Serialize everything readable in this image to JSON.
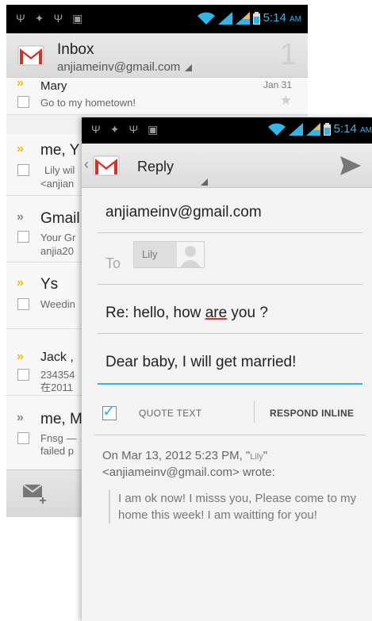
{
  "status_bar": {
    "time": "5:14",
    "ampm": "AM"
  },
  "inbox": {
    "title": "Inbox",
    "account": "anjiameinv@gmail.com",
    "unread_count": "1",
    "messages": [
      {
        "sender": "Mary",
        "preview_line1": "Go to my hometown!",
        "preview_line2": "",
        "date": "Jan 31",
        "important": true
      },
      {
        "sender": "me, Y",
        "preview_line1": "Lily wil",
        "preview_line2": "<anjian",
        "date": "",
        "important": true
      },
      {
        "sender": "Gmail",
        "preview_line1": "Your Gr",
        "preview_line2": "anjia20",
        "date": "",
        "important": false
      },
      {
        "sender": "Ys",
        "preview_line1": "Weedin",
        "preview_line2": "",
        "date": "",
        "important": true
      },
      {
        "sender": "Jack ,",
        "preview_line1": "234354",
        "preview_line2": "在2011",
        "date": "",
        "important": true
      },
      {
        "sender": "me, M",
        "preview_line1": "Fnsg —",
        "preview_line2": "failed p",
        "date": "",
        "important": false
      }
    ]
  },
  "reply": {
    "title": "Reply",
    "from": "anjiameinv@gmail.com",
    "to_label": "To",
    "recipient": "Lily",
    "subject_before": "Re: hello, how ",
    "subject_misspelled": "are",
    "subject_after": " you ?",
    "body": "Dear baby, I will get married!",
    "quote_text_label": "QUOTE TEXT",
    "quote_text_checked": true,
    "respond_inline_label": "RESPOND INLINE",
    "attribution_prefix": "On Mar 13, 2012 5:23 PM, \"",
    "attribution_name": "Lily",
    "attribution_suffix": "\"",
    "attribution_line2": "<anjiameinv@gmail.com> wrote:",
    "quoted_text": "I am ok now! I misss you, Please come to my home this week! I am waitting for you!"
  },
  "colors": {
    "accent": "#33b5e5",
    "important": "#e8c400",
    "gmail_red": "#d93025"
  },
  "icons": [
    "usb-icon",
    "android-icon",
    "wifi-icon",
    "signal-icon",
    "battery-icon",
    "gmail-logo-icon",
    "send-icon",
    "compose-icon",
    "avatar-icon",
    "star-icon"
  ]
}
